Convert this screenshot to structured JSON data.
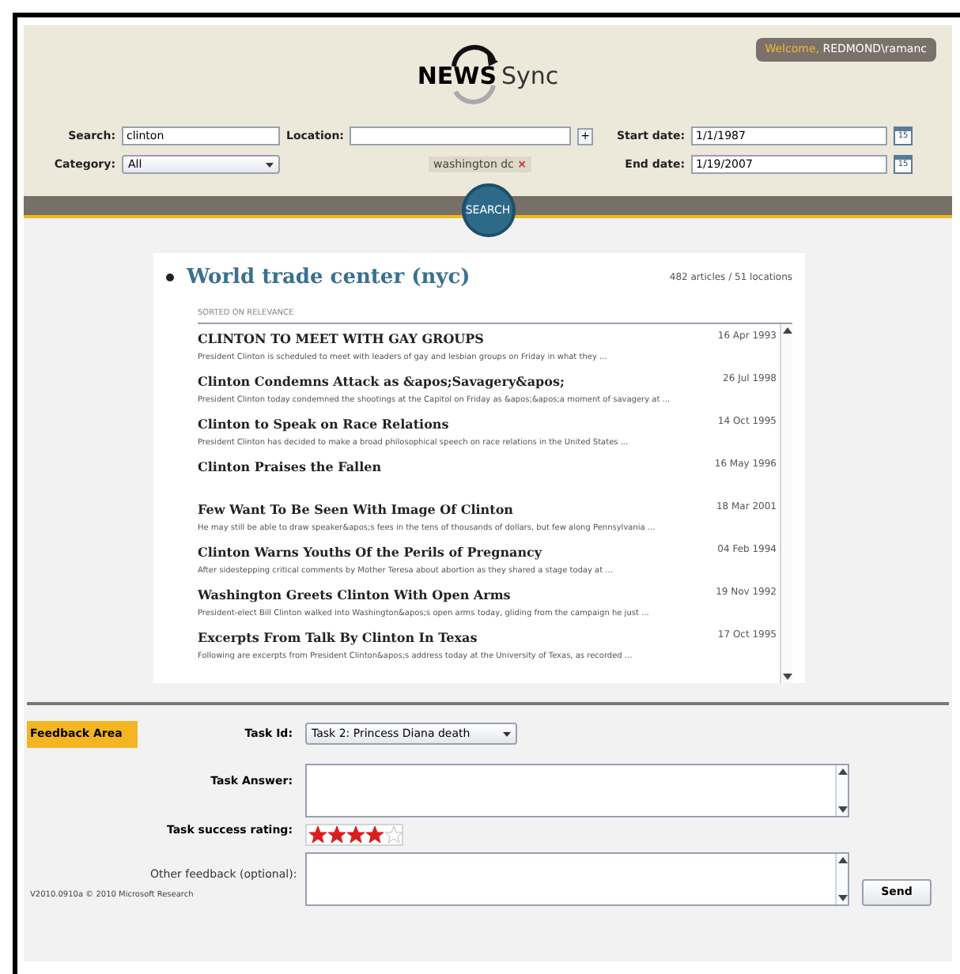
{
  "header": {
    "welcome": "Welcome,",
    "user": "REDMOND\\ramanc",
    "logo_bold": "NEWS",
    "logo_light": "Sync"
  },
  "filters": {
    "search_label": "Search:",
    "search_value": "clinton",
    "category_label": "Category:",
    "category_value": "All",
    "location_label": "Location:",
    "add_button": "+",
    "location_tags": [
      {
        "label": "washington dc",
        "remove": "×"
      }
    ],
    "start_label": "Start date:",
    "start_value": "1/1/1987",
    "end_label": "End date:",
    "end_value": "1/19/2007",
    "start_calendar_day": "15",
    "end_calendar_day": "15"
  },
  "search_button": "SEARCH",
  "story": {
    "title": "World trade center (nyc)",
    "stats": "482 articles / 51 locations",
    "sort_label": "SORTED ON RELEVANCE",
    "articles": [
      {
        "title": "CLINTON TO MEET WITH GAY GROUPS",
        "date": "16 Apr 1993",
        "snippet": "President Clinton is scheduled to meet with leaders of gay and lesbian groups on Friday in what they ..."
      },
      {
        "title": "Clinton Condemns Attack as &apos;Savagery&apos;",
        "date": "26 Jul 1998",
        "snippet": "President Clinton today condemned the shootings at the Capitol on Friday as &apos;&apos;a moment of savagery at ..."
      },
      {
        "title": "Clinton to Speak on Race Relations",
        "date": "14 Oct 1995",
        "snippet": "President Clinton has decided to make a broad philosophical speech on race relations in the United States ..."
      },
      {
        "title": "Clinton Praises the Fallen",
        "date": "16 May 1996"
      },
      {
        "title": "Few Want To Be Seen With Image Of Clinton",
        "date": "18 Mar 2001",
        "snippet": "He may still be able to draw speaker&apos;s fees in the tens of thousands of dollars, but few along Pennsylvania ..."
      },
      {
        "title": "Clinton Warns Youths Of the Perils of Pregnancy",
        "date": "04 Feb 1994",
        "snippet": "After sidestepping critical comments by Mother Teresa about abortion as they shared a stage today at ..."
      },
      {
        "title": "Washington Greets Clinton With Open Arms",
        "date": "19 Nov 1992",
        "snippet": "President-elect Bill Clinton walked into Washington&apos;s open arms today, gliding from the campaign he just ..."
      },
      {
        "title": "Excerpts From Talk By Clinton In Texas",
        "date": "17 Oct 1995",
        "snippet": "Following are excerpts from President Clinton&apos;s address today at the University of Texas, as recorded ..."
      }
    ]
  },
  "feedback": {
    "area_label": "Feedback Area",
    "task_id_label": "Task Id:",
    "task_id_value": "Task 2: Princess Diana death",
    "answer_label": "Task Answer:",
    "rating_label": "Task success rating:",
    "stars": 4,
    "other_label": "Other feedback (optional):",
    "send_button": "Send",
    "version": "V2010.0910a © 2010 Microsoft Research"
  }
}
